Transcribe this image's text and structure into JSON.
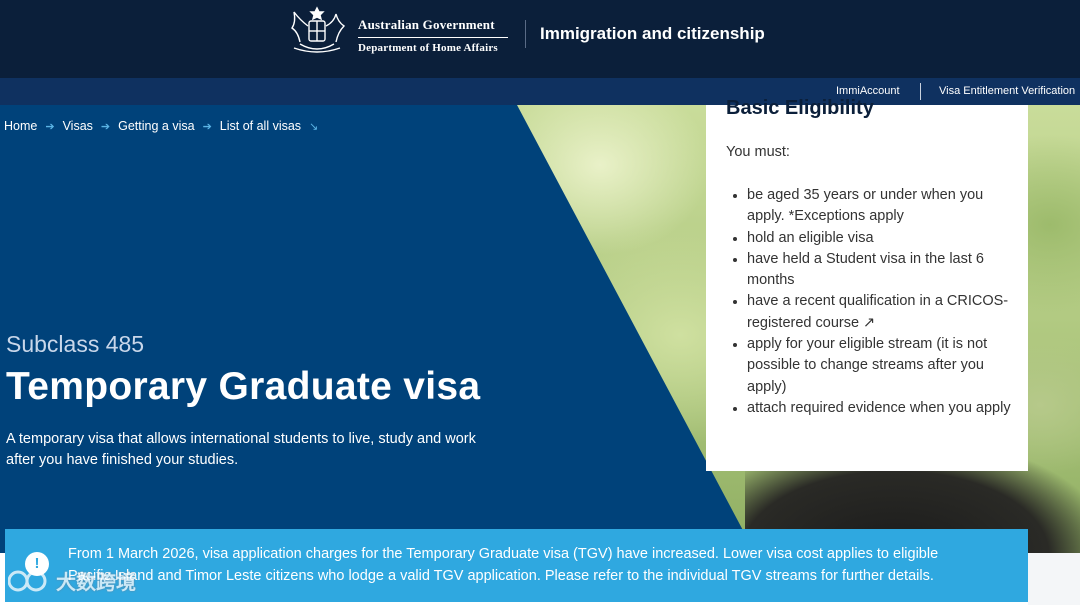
{
  "header": {
    "gov_name": "Australian Government",
    "department": "Department of Home Affairs",
    "site_title": "Immigration and citizenship",
    "colors": {
      "header_bg": "#0b1f3a",
      "utility_bg": "#0f3160"
    }
  },
  "utility_nav": {
    "links": [
      "ImmiAccount",
      "Visa Entitlement Verification"
    ]
  },
  "breadcrumb": {
    "items": [
      "Home",
      "Visas",
      "Getting a visa",
      "List of all visas"
    ],
    "separator_icon": "arrow-right-icon",
    "trailing_icon": "arrow-down-right-icon"
  },
  "hero": {
    "subclass": "Subclass 485",
    "title": "Temporary Graduate visa",
    "description": "A temporary visa that allows international students to live, study and work after you have finished your studies.",
    "colors": {
      "panel": "#00427a",
      "accent": "#5bb4e5"
    }
  },
  "eligibility": {
    "title": "Basic Eligibility",
    "intro": "You must:",
    "items": [
      "be aged 35 years or under when you apply. *Exceptions apply",
      "hold an eligible visa",
      "have held a Student visa in the last 6 months",
      "have a recent qualification in a CRICOS-registered course ↗",
      "apply for your eligible stream (it is not possible to change streams after you apply)",
      "attach required evidence when you apply"
    ]
  },
  "notice": {
    "icon": "info-alert-icon",
    "text": "From 1 March 2026, visa application charges for the Temporary Graduate visa (TGV) have increased. Lower visa cost applies to eligible Pacific Island and Timor Leste citizens who lodge a valid TGV application. Please refer to the individual TGV streams for further details.",
    "color": "#2fa8e0"
  },
  "watermark": {
    "text": "大数跨境"
  }
}
